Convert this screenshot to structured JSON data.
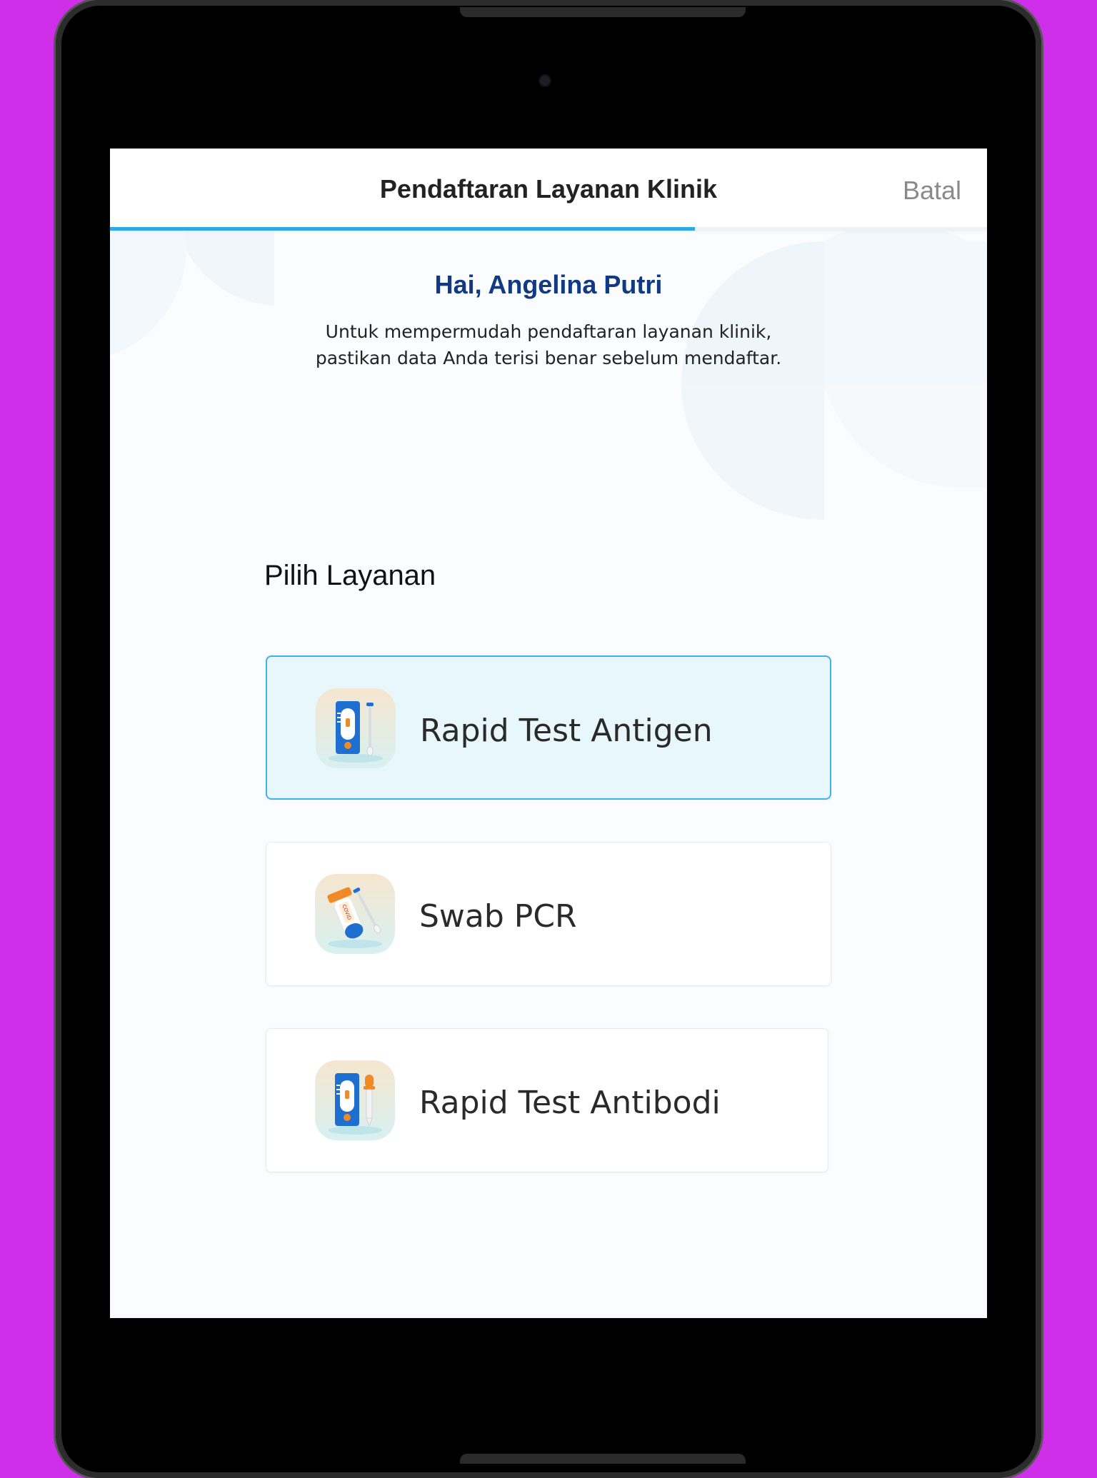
{
  "header": {
    "title": "Pendaftaran Layanan Klinik",
    "cancel_label": "Batal",
    "progress_percent": 66.7
  },
  "intro": {
    "greeting": "Hai, Angelina Putri",
    "line1": "Untuk mempermudah pendaftaran layanan klinik,",
    "line2": "pastikan data Anda terisi benar sebelum mendaftar."
  },
  "services": {
    "section_title": "Pilih Layanan",
    "items": [
      {
        "label": "Rapid Test Antigen",
        "icon": "antigen-test-kit-icon",
        "selected": true
      },
      {
        "label": "Swab PCR",
        "icon": "pcr-swab-tube-icon",
        "selected": false
      },
      {
        "label": "Rapid Test Antibodi",
        "icon": "antibody-test-kit-icon",
        "selected": false
      }
    ]
  },
  "colors": {
    "background": "#cf2fe9",
    "accent": "#2ea8e8",
    "greeting": "#113a82",
    "selected_card": "#e7f7fc"
  }
}
